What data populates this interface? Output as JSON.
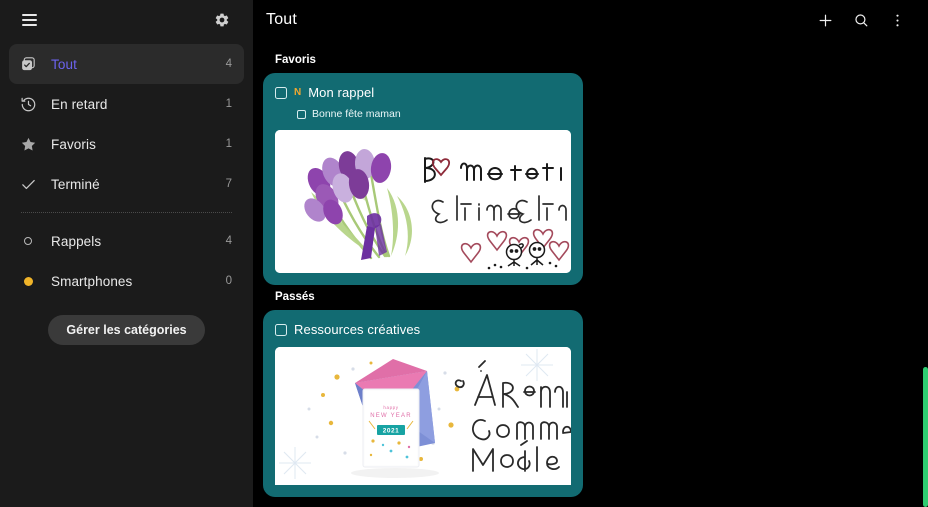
{
  "sidebar": {
    "menu_icon": "hamburger-icon",
    "settings_icon": "gear-icon",
    "items": [
      {
        "id": "tout",
        "label": "Tout",
        "count": "4",
        "icon": "checkbox-stack-icon",
        "selected": true
      },
      {
        "id": "en-retard",
        "label": "En retard",
        "count": "1",
        "icon": "history-clock-icon",
        "selected": false
      },
      {
        "id": "favoris",
        "label": "Favoris",
        "count": "1",
        "icon": "star-icon",
        "selected": false
      },
      {
        "id": "termine",
        "label": "Terminé",
        "count": "7",
        "icon": "check-icon",
        "selected": false
      }
    ],
    "categories": [
      {
        "id": "rappels",
        "label": "Rappels",
        "count": "4",
        "icon": "circle-outline-icon",
        "color": "#b9b9b9"
      },
      {
        "id": "smartphones",
        "label": "Smartphones",
        "count": "0",
        "icon": "circle-filled-icon",
        "color": "#f0b429"
      }
    ],
    "manage_button": "Gérer les catégories"
  },
  "header": {
    "title": "Tout",
    "actions": [
      {
        "id": "add",
        "icon": "plus-icon"
      },
      {
        "id": "search",
        "icon": "search-icon"
      },
      {
        "id": "more",
        "icon": "more-vertical-icon"
      }
    ]
  },
  "main": {
    "sections": [
      {
        "id": "favoris",
        "label": "Favoris",
        "card": {
          "title": "Mon rappel",
          "badge": "N",
          "subtask": "Bonne fête maman",
          "image_alt": "purple-tulips-bouquet-handwritten-bonne-fete-maman-card",
          "image_text_line1": "Bonne fête maman",
          "image_text_line2": "Je t'aime, Je t'adore"
        }
      },
      {
        "id": "passes",
        "label": "Passés",
        "card": {
          "title": "Ressources créatives",
          "badge": "",
          "subtask": "",
          "image_alt": "pink-blue-envelope-new-year-card-with-handwriting",
          "image_text_line1": "happy NEW YEAR",
          "image_text_line2": "2021",
          "handwriting": [
            "À Reprendre",
            "Comme",
            "Modèle"
          ]
        }
      }
    ]
  },
  "colors": {
    "card_teal": "#126b72",
    "accent_purple": "#6c63ef",
    "badge_orange": "#f0a830",
    "category_dot": "#f0b429",
    "scrollbar_green": "#2ecc71",
    "sidebar_bg": "#1b1b1b",
    "main_bg": "#000000"
  },
  "scrollbar": {
    "name": "vertical-scrollbar"
  }
}
